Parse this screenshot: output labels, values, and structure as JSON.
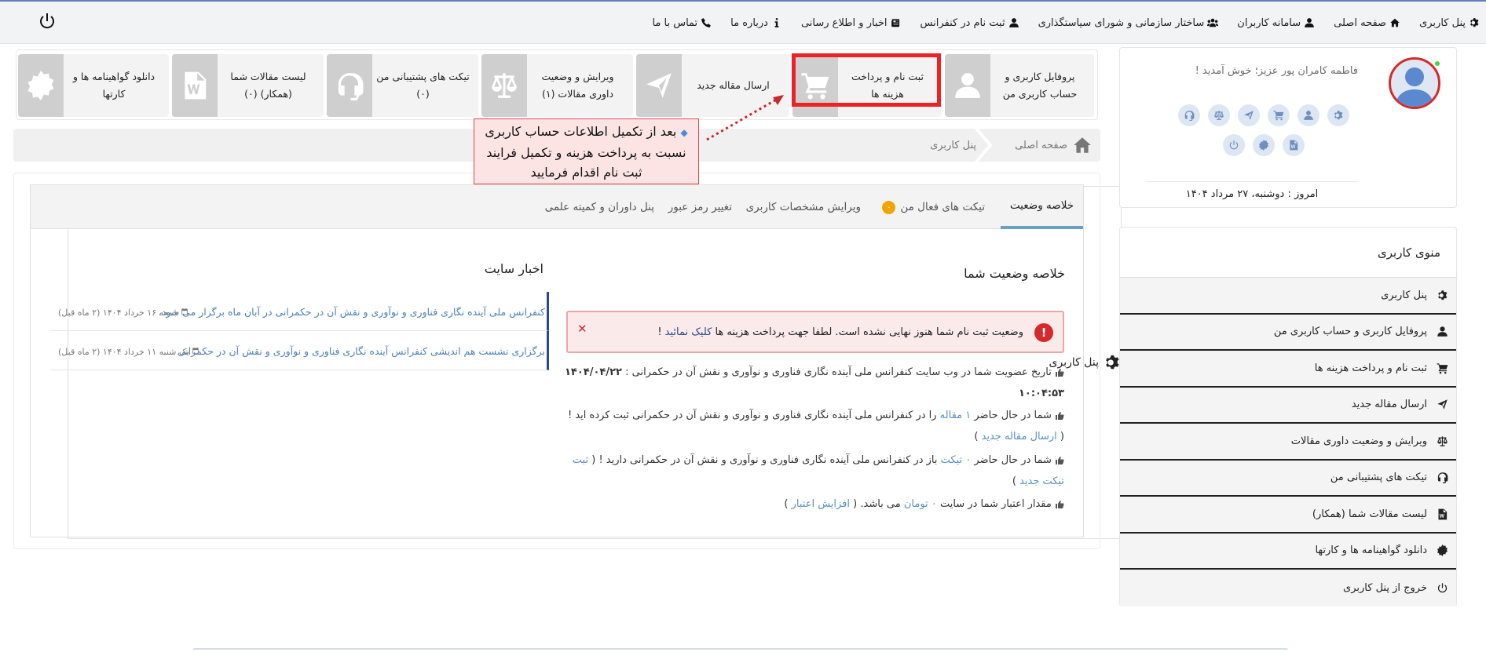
{
  "nav": {
    "items": [
      {
        "label": "پنل کاربری",
        "icon": "gear-icon"
      },
      {
        "label": "صفحه اصلی",
        "icon": "home-icon"
      },
      {
        "label": "سامانه کاربران",
        "icon": "user-icon"
      },
      {
        "label": "ساختار سازمانی و شورای سیاستگذاری",
        "icon": "users-icon"
      },
      {
        "label": "ثبت نام در کنفرانس",
        "icon": "user-icon"
      },
      {
        "label": "اخبار و اطلاع رسانی",
        "icon": "newspaper-icon"
      },
      {
        "label": "درباره ما",
        "icon": "info-icon"
      },
      {
        "label": "تماس با ما",
        "icon": "phone-icon"
      }
    ],
    "panel_label": "پنل کاربری"
  },
  "profile": {
    "welcome": "فاطمه کامران پور عزیز؛ خوش آمدید !",
    "date": "امروز : دوشنبه، ۲۷ مرداد ۱۴۰۴"
  },
  "sidebar": {
    "title": "منوی کاربری",
    "items": [
      {
        "label": "پنل کاربری",
        "icon": "gear-icon"
      },
      {
        "label": "پروفایل کاربری و حساب کاربری من",
        "icon": "user-icon"
      },
      {
        "label": "ثبت نام و پرداخت هزینه ها",
        "icon": "cart-icon"
      },
      {
        "label": "ارسال مقاله جدید",
        "icon": "send-icon"
      },
      {
        "label": "ویرایش و وضعیت داوری مقالات",
        "icon": "scale-icon"
      },
      {
        "label": "تیکت های پشتیبانی من",
        "icon": "headset-icon"
      },
      {
        "label": "لیست مقالات شما (همکار)",
        "icon": "file-icon"
      },
      {
        "label": "دانلود گواهینامه ها و کارتها",
        "icon": "certificate-icon"
      },
      {
        "label": "خروج از پنل کاربری",
        "icon": "power-icon"
      }
    ]
  },
  "tiles": [
    {
      "label": "پروفایل کاربری و حساب کاربری من",
      "icon": "user-icon"
    },
    {
      "label": "ثبت نام و پرداخت هزینه ها",
      "icon": "cart-icon"
    },
    {
      "label": "ارسال مقاله جدید",
      "icon": "send-icon"
    },
    {
      "label": "ویرایش و وضعیت داوری مقالات (۱)",
      "icon": "scale-icon"
    },
    {
      "label": "تیکت های پشتیبانی من (۰)",
      "icon": "headset-icon"
    },
    {
      "label": "لیست مقالات شما (همکار) (۰)",
      "icon": "file-icon"
    },
    {
      "label": "دانلود گواهینامه ها و کارتها",
      "icon": "certificate-icon"
    }
  ],
  "callout": {
    "lines": [
      "بعد از تکمیل اطلاعات حساب کاربری",
      "نسبت به پرداخت هزینه و تکمیل فرایند",
      "ثبت نام اقدام فرمایید"
    ]
  },
  "breadcrumb": {
    "home": "صفحه اصلی",
    "current": "پنل کاربری"
  },
  "tabs": [
    {
      "label": "خلاصه وضعیت",
      "active": true
    },
    {
      "label": "تیکت های فعال من",
      "badge": "۰"
    },
    {
      "label": "ویرایش مشخصات کاربری"
    },
    {
      "label": "تغییر رمز عبور"
    },
    {
      "label": "پنل داوران و کمیته علمی"
    }
  ],
  "summary": {
    "title": "خلاصه وضعیت شما",
    "alert": {
      "text": "وضعیت ثبت نام شما هنوز نهایی نشده است. لطفا جهت پرداخت هزینه ها",
      "link": "کلیک نمائید",
      "after": "!"
    },
    "lines": [
      {
        "text": "تاریخ عضویت شما در وب سایت کنفرانس ملی آینده نگاری فناوری و نوآوری و نقش آن در حکمرانی :",
        "value": "۱۴۰۴/۰۴/۲۲ ۱۰:۰۴:۵۳"
      },
      {
        "pre": "شما در حال حاضر",
        "count": "۱ مقاله",
        "mid": "را در کنفرانس ملی آینده نگاری فناوری و نوآوری و نقش آن در حکمرانی ثبت کرده اید ! (",
        "link": "ارسال مقاله جدید",
        "post": ")"
      },
      {
        "pre": "شما در حال حاضر",
        "count": "۰ تیکت",
        "mid": "باز در کنفرانس ملی آینده نگاری فناوری و نوآوری و نقش آن در حکمرانی دارید ! (",
        "link": "ثبت تیکت جدید",
        "post": ")"
      },
      {
        "pre": "مقدار اعتبار شما در سایت",
        "count": "۰ تومان",
        "mid": "می باشد. (",
        "link": "افزایش اعتبار",
        "post": ")"
      }
    ]
  },
  "news": {
    "title": "اخبار سایت",
    "items": [
      {
        "title": "کنفرانس ملی آینده نگاری فناوری و نوآوری و نقش آن در حکمرانی در آبان ماه برگزار می شود.",
        "meta": "جمعه ۱۶ خرداد ۱۴۰۴ (۲ ماه قبل)"
      },
      {
        "title": "برگزاری نشست هم اندیشی کنفرانس آینده نگاری فناوری و نوآوری و نقش آن در حکمرانی",
        "meta": "یک شنبه ۱۱ خرداد ۱۴۰۴ (۲ ماه قبل)"
      }
    ]
  },
  "colors": {
    "accent": "#6a9fc6",
    "highlight": "#ec2227",
    "alert": "#d6292c"
  }
}
